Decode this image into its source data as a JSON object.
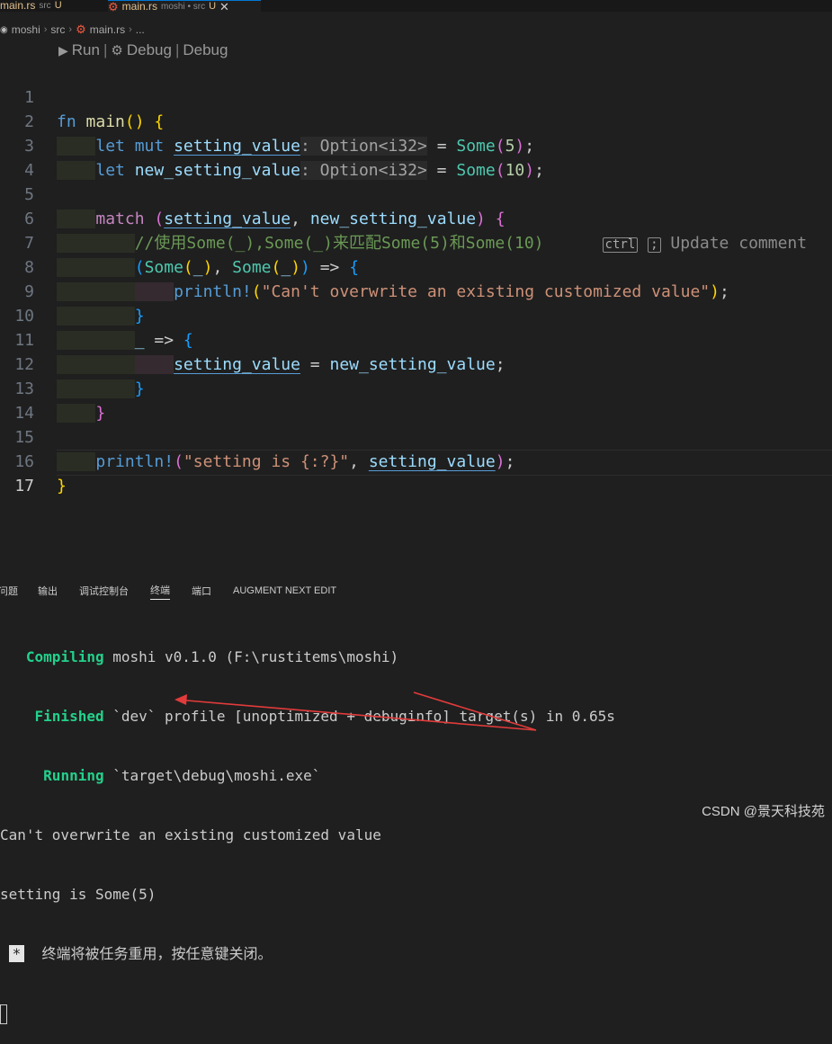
{
  "tabs": [
    {
      "name": "main.rs",
      "dir": "src",
      "status": "U"
    },
    {
      "name": "main.rs",
      "dir": "moshi • src",
      "status": "U"
    }
  ],
  "breadcrumb": [
    "moshi",
    "src",
    "main.rs",
    "..."
  ],
  "codelens": {
    "run": "Run",
    "debug1": "Debug",
    "debug2": "Debug"
  },
  "editor": {
    "line_numbers": [
      "1",
      "2",
      "3",
      "4",
      "5",
      "6",
      "7",
      "8",
      "9",
      "10",
      "11",
      "12",
      "13",
      "14",
      "15",
      "16",
      "17"
    ],
    "inline_hint": {
      "ctrl": "ctrl",
      "semi": ";",
      "text": "Update comment"
    }
  },
  "panel": {
    "tabs": [
      "问题",
      "输出",
      "调试控制台",
      "终端",
      "端口",
      "AUGMENT NEXT EDIT"
    ],
    "active_tab": "终端"
  },
  "terminal": {
    "compiling_label": "Compiling",
    "compiling_text": " moshi v0.1.0 (F:\\rustitems\\moshi)",
    "finished_label": "Finished",
    "finished_text": " `dev` profile [unoptimized + debuginfo] target(s) in 0.65s",
    "running_label": "Running",
    "running_text": " `target\\debug\\moshi.exe`",
    "out1": "Can't overwrite an existing customized value",
    "out2": "setting is Some(5)",
    "star": "*",
    "reuse_msg": "终端将被任务重用，按任意键关闭。"
  },
  "watermark": "CSDN @景天科技苑",
  "colors": {
    "background": "#1f1f1f",
    "keyword": "#569cd6",
    "string": "#ce9178",
    "comment": "#6a9955",
    "terminal_green": "#23d18b",
    "arrow": "#e23b3b"
  }
}
